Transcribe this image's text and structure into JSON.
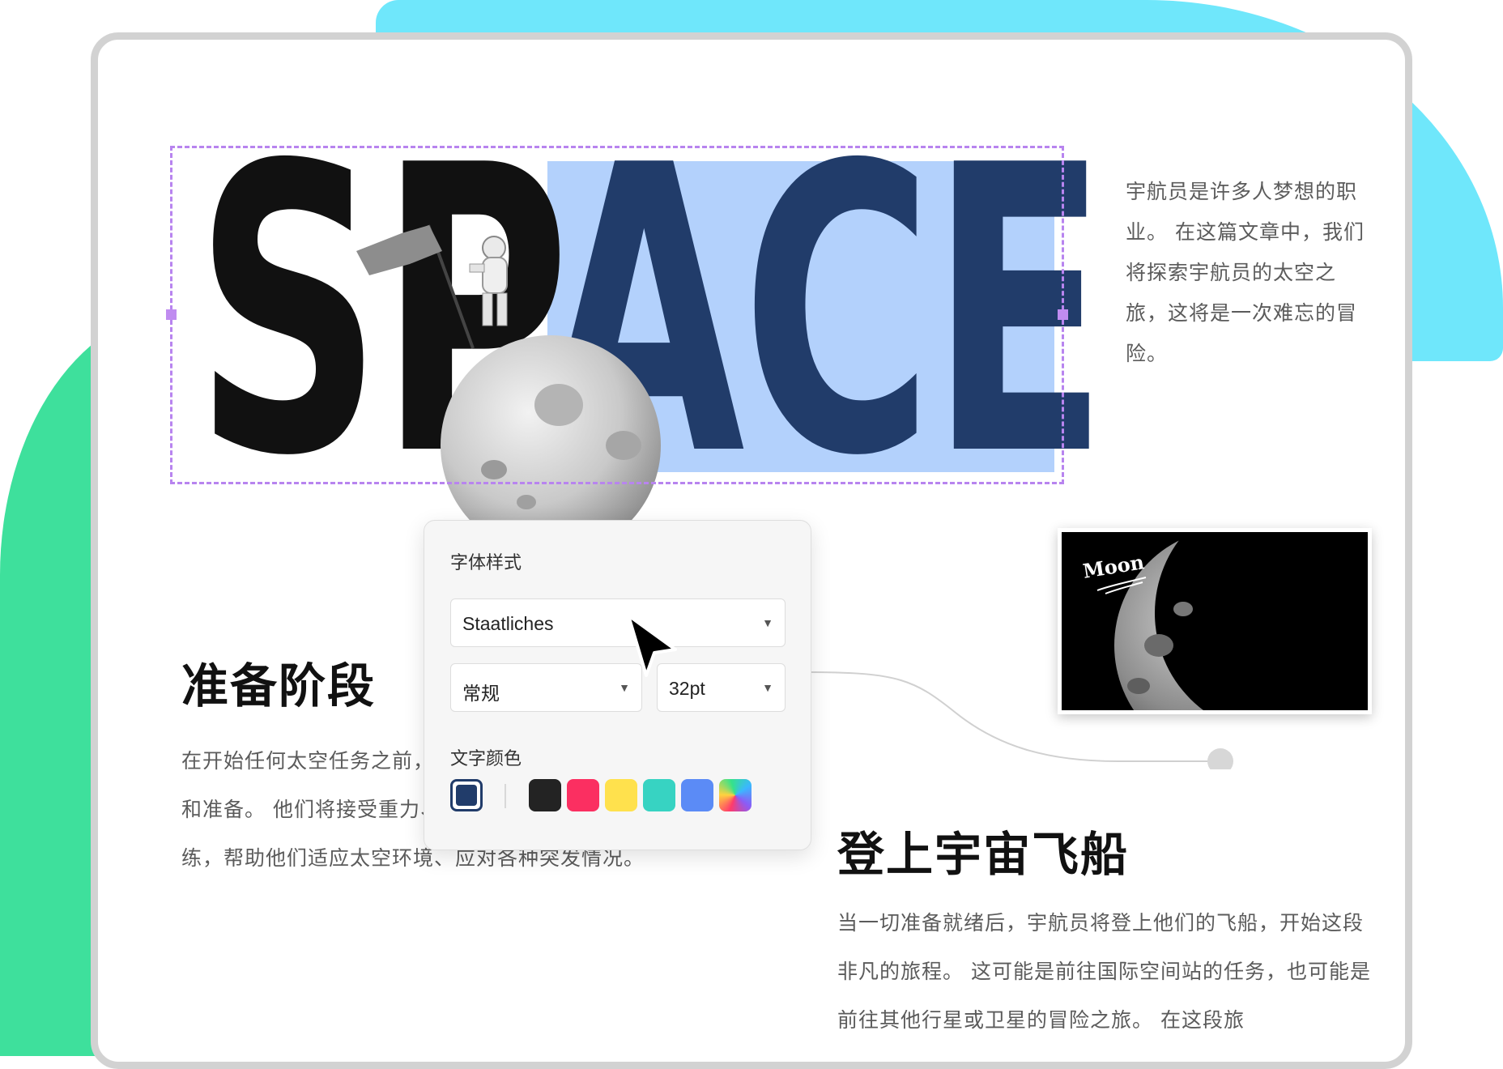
{
  "headline": {
    "dark_part": "SP",
    "highlight_part": "ACE"
  },
  "intro_text": "宇航员是许多人梦想的职业。 在这篇文章中，我们将探索宇航员的太空之旅，这将是一次难忘的冒险。",
  "section_prep": {
    "title": "准备阶段",
    "body": "在开始任何太空任务之前，宇航员们需要接受严格的训练和准备。 他们将接受重力、失重、空间飞行等各类专业训练，帮助他们适应太空环境、应对各种突发情况。"
  },
  "section_board": {
    "title": "登上宇宙飞船",
    "body": "当一切准备就绪后，宇航员将登上他们的飞船，开始这段非凡的旅程。 这可能是前往国际空间站的任务，也可能是前往其他行星或卫星的冒险之旅。 在这段旅"
  },
  "moon_photo": {
    "label": "Moon"
  },
  "font_panel": {
    "title": "字体样式",
    "font_family": "Staatliches",
    "font_weight": "常规",
    "font_size": "32pt",
    "color_label": "文字颜色",
    "selected_color": "#213c6a",
    "swatches": [
      "#232323",
      "#fb2f61",
      "#ffe14d",
      "#37d3c2",
      "#5b8bf6",
      "rainbow"
    ]
  },
  "colors": {
    "headline_dark": "#111111",
    "headline_navy": "#213c6a",
    "highlight": "#b3d1fc",
    "selection": "#b884ef",
    "bg_cyan": "#6fe7fb",
    "bg_green": "#3ee09c"
  },
  "icons": [
    "dropdown-caret-icon",
    "mouse-pointer-icon"
  ]
}
